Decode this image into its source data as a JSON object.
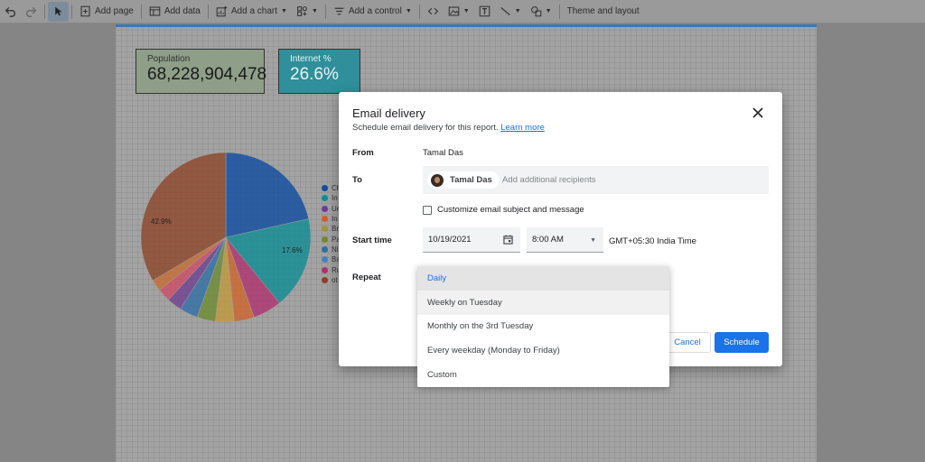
{
  "toolbar": {
    "add_page": "Add page",
    "add_data": "Add data",
    "add_chart": "Add a chart",
    "add_control": "Add a control",
    "theme": "Theme and layout"
  },
  "report": {
    "scorecards": [
      {
        "label": "Population",
        "value": "68,228,904,478"
      },
      {
        "label": "Internet %",
        "value": "26.6%"
      }
    ],
    "pie": {
      "type": "pie",
      "slices_pct": [
        21.5,
        17.6,
        5.5,
        3.8,
        3.6,
        3.5,
        3.5,
        2.8,
        2.5,
        2.2,
        33.5
      ],
      "visible_labels": [
        "17.6%",
        "42.9%"
      ],
      "legend_labels": [
        "Ch",
        "In",
        "Ur",
        "In",
        "Br",
        "Pa",
        "Ni",
        "Ba",
        "Ru",
        "ot"
      ],
      "colors": [
        "#0d4fa0",
        "#0b8f94",
        "#6a3d9a",
        "#d35c2d",
        "#a8913a",
        "#6f8b2f",
        "#2f6fa0",
        "#4a7fc0",
        "#b0306e",
        "#8c4126"
      ],
      "slice_colors": [
        "#0b4aa0",
        "#0b8c93",
        "#b0306e",
        "#d0642a",
        "#c29a3a",
        "#6d8a2f",
        "#2f6ea6",
        "#6c3e8f",
        "#cf4a63",
        "#c66b2f",
        "#8d4327"
      ]
    }
  },
  "dialog": {
    "title": "Email delivery",
    "subtitle": "Schedule email delivery for this report.",
    "learn_more": "Learn more",
    "from_label": "From",
    "from_value": "Tamal Das",
    "to_label": "To",
    "recipient_name": "Tamal Das",
    "to_placeholder": "Add additional recipients",
    "customize_label": "Customize email subject and message",
    "start_time_label": "Start time",
    "date_value": "10/19/2021",
    "time_value": "8:00 AM",
    "timezone": "GMT+05:30 India Time",
    "repeat_label": "Repeat",
    "cancel": "Cancel",
    "schedule": "Schedule"
  },
  "repeat_options": {
    "items": [
      "Daily",
      "Weekly on Tuesday",
      "Monthly on the 3rd Tuesday",
      "Every weekday (Monday to Friday)",
      "Custom"
    ],
    "selected": "Daily"
  }
}
